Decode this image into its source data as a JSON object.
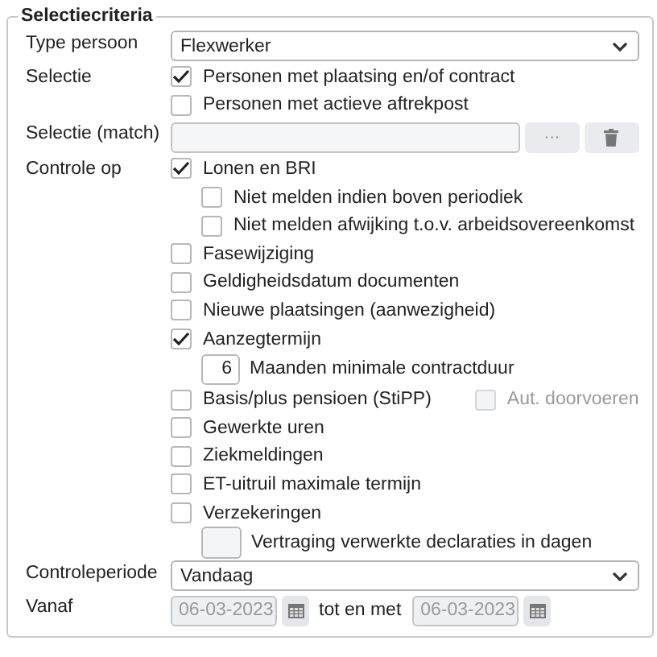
{
  "title": "Selectiecriteria",
  "rows": [
    {
      "kind": "select",
      "label": "Type persoon",
      "value": "Flexwerker"
    },
    {
      "kind": "checks",
      "label": "Selectie",
      "items": [
        {
          "kind": "check",
          "label": "Personen met plaatsing en/of contract",
          "checked": true
        },
        {
          "kind": "check",
          "label": "Personen met actieve aftrekpost",
          "checked": false
        }
      ]
    },
    {
      "kind": "match",
      "label": "Selectie (match)",
      "button": "···"
    },
    {
      "kind": "checks",
      "label": "Controle op",
      "items": [
        {
          "kind": "check",
          "label": "Lonen en BRI",
          "checked": true,
          "children": [
            {
              "kind": "check",
              "label": "Niet melden indien boven periodiek",
              "checked": false
            },
            {
              "kind": "check",
              "label": "Niet melden afwijking t.o.v. arbeidsovereenkomst",
              "checked": false
            }
          ]
        },
        {
          "kind": "check",
          "label": "Fasewijziging",
          "checked": false
        },
        {
          "kind": "check",
          "label": "Geldigheidsdatum documenten",
          "checked": false
        },
        {
          "kind": "check",
          "label": "Nieuwe plaatsingen (aanwezigheid)",
          "checked": false
        },
        {
          "kind": "check",
          "label": "Aanzegtermijn",
          "checked": true,
          "children": [
            {
              "kind": "number",
              "value": "6",
              "label": "Maanden minimale contractduur"
            }
          ]
        },
        {
          "kind": "check",
          "label": "Basis/plus pensioen (StiPP)",
          "checked": false,
          "extra": {
            "label": "Aut. doorvoeren",
            "checked": false,
            "disabled": true
          }
        },
        {
          "kind": "check",
          "label": "Gewerkte uren",
          "checked": false
        },
        {
          "kind": "check",
          "label": "Ziekmeldingen",
          "checked": false
        },
        {
          "kind": "check",
          "label": "ET-uitruil maximale termijn",
          "checked": false
        },
        {
          "kind": "check",
          "label": "Verzekeringen",
          "checked": false,
          "children": [
            {
              "kind": "number",
              "label": "Vertraging verwerkte declaraties in dagen"
            }
          ]
        }
      ]
    },
    {
      "kind": "select",
      "label": "Controleperiode",
      "value": "Vandaag"
    },
    {
      "kind": "daterange",
      "label": "Vanaf",
      "from": "06-03-2023",
      "separator": "tot en met",
      "to": "06-03-2023",
      "disabled": true
    }
  ]
}
